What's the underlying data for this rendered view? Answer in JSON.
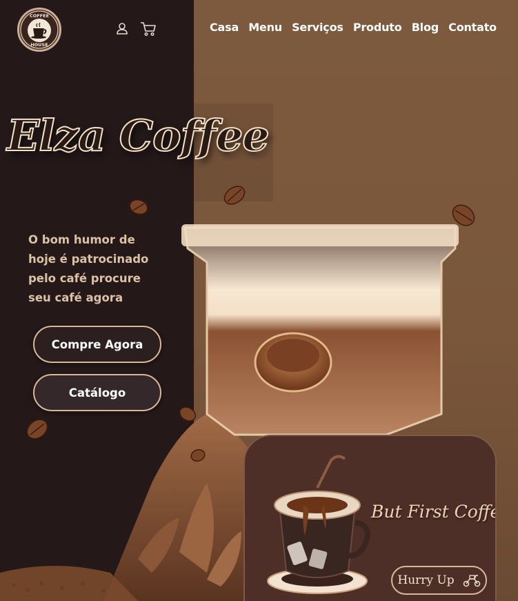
{
  "header": {
    "logo_text_top": "COFFEE",
    "logo_text_bottom": "HOUSE",
    "nav": [
      "Casa",
      "Menu",
      "Serviços",
      "Produto",
      "Blog",
      "Contato"
    ]
  },
  "hero": {
    "title": "Elza Coffee",
    "tagline": "O bom humor de hoje é patrocinado pelo café procure seu café agora",
    "buy_label": "Compre Agora",
    "catalog_label": "Catálogo"
  },
  "promo": {
    "text": "But First Coffee",
    "button_label": "Hurry Up"
  },
  "colors": {
    "dark_panel": "#241819",
    "right_panel": "#7a573c",
    "accent": "#d9b996",
    "promo_card": "#4e2f28"
  },
  "icons": [
    "user-icon",
    "cart-icon",
    "scooter-icon"
  ]
}
